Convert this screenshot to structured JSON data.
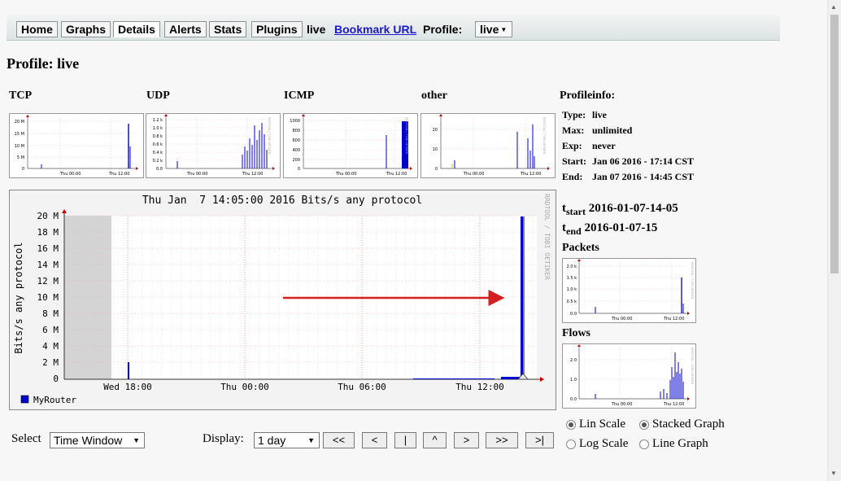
{
  "nav": {
    "tabs": [
      "Home",
      "Graphs",
      "Details",
      "Alerts",
      "Stats",
      "Plugins"
    ],
    "active_tab": "Details",
    "live_text": "live",
    "bookmark_link": "Bookmark URL",
    "profile_label": "Profile:",
    "profile_value": "live"
  },
  "page_title": "Profile: live",
  "thumbnails": [
    {
      "label": "TCP",
      "y_ticks": [
        "20 M",
        "15 M",
        "10 M",
        "5 M",
        "0"
      ],
      "x_ticks": [
        "Thu 00:00",
        "Thu 12:00"
      ]
    },
    {
      "label": "UDP",
      "y_ticks": [
        "1.2 k",
        "1.0 k",
        "0.8 k",
        "0.6 k",
        "0.4 k",
        "0.2 k",
        "0.0"
      ],
      "x_ticks": [
        "Thu 00:00",
        "Thu 12:00"
      ]
    },
    {
      "label": "ICMP",
      "y_ticks": [
        "1000",
        "800",
        "600",
        "400",
        "200",
        "0"
      ],
      "x_ticks": [
        "Thu 00:00",
        "Thu 12:00"
      ]
    },
    {
      "label": "other",
      "y_ticks": [
        "20",
        "10",
        "0"
      ],
      "x_ticks": [
        "Thu 00:00",
        "Thu 12:00"
      ]
    }
  ],
  "profileinfo": {
    "title": "Profileinfo:",
    "type_label": "Type:",
    "type_value": "live",
    "max_label": "Max:",
    "max_value": "unlimited",
    "exp_label": "Exp:",
    "exp_value": "never",
    "start_label": "Start:",
    "start_value": "Jan 06 2016 - 17:14 CST",
    "end_label": "End:",
    "end_value": "Jan 07 2016 - 14:45 CST"
  },
  "time_window": {
    "tstart_t": "t",
    "tstart_sub": "start",
    "tstart_value": "2016-01-07-14-05",
    "tend_t": "t",
    "tend_sub": "end",
    "tend_value": "2016-01-07-15"
  },
  "side_graphs": {
    "packets_label": "Packets",
    "packets_y_ticks": [
      "2.0 k",
      "1.5 k",
      "1.0 k",
      "0.5 k",
      "0.0"
    ],
    "flows_label": "Flows",
    "flows_y_ticks": [
      "2.0",
      "1.0",
      "0.0"
    ],
    "x_ticks": [
      "Thu 00:00",
      "Thu 12:00"
    ]
  },
  "main_graph": {
    "title": "Thu Jan  7 14:05:00 2016 Bits/s any protocol",
    "ylabel": "Bits/s any protocol",
    "y_ticks": [
      "20 M",
      "18 M",
      "16 M",
      "14 M",
      "12 M",
      "10 M",
      "8 M",
      "6 M",
      "4 M",
      "2 M",
      "0"
    ],
    "x_ticks": [
      "Wed 18:00",
      "Thu 00:00",
      "Thu 06:00",
      "Thu 12:00"
    ],
    "legend": "MyRouter",
    "watermark": "RRDTOOL / TOBI OETIKER",
    "series_color": "#0000cc"
  },
  "controls": {
    "select_label": "Select",
    "select_value": "Time Window",
    "display_label": "Display:",
    "display_value": "1 day",
    "nav_buttons": [
      "<<",
      "<",
      "|",
      "^",
      ">",
      ">>",
      ">|"
    ],
    "lin_scale": "Lin Scale",
    "log_scale": "Log Scale",
    "stacked_graph": "Stacked Graph",
    "line_graph": "Line Graph"
  }
}
